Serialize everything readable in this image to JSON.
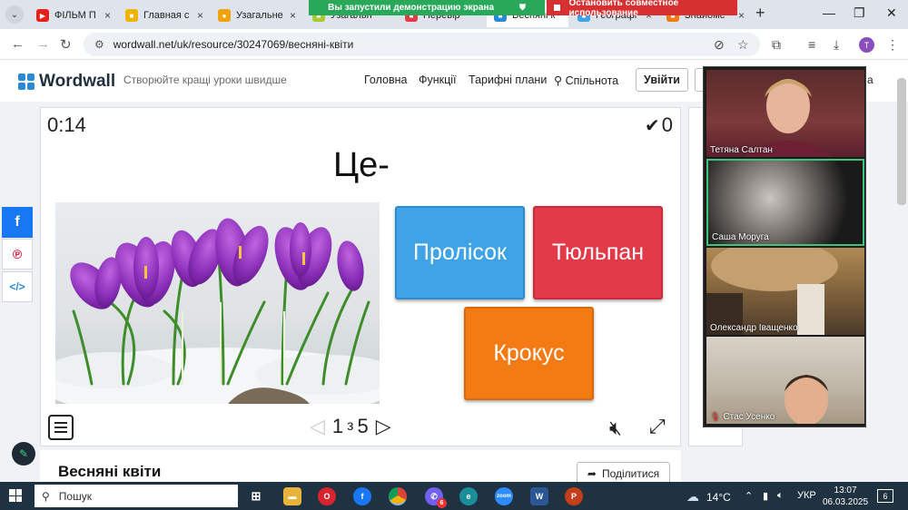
{
  "browser": {
    "tabs": [
      {
        "title": "ФІЛЬМ П",
        "color": "#e62117"
      },
      {
        "title": "Главная с",
        "color": "#f0b400"
      },
      {
        "title": "Узагальне",
        "color": "#f2a20c"
      },
      {
        "title": "Узагальн",
        "color": "#a8c934"
      },
      {
        "title": "Перевір",
        "color": "#e23a48"
      },
      {
        "title": "Весняні к",
        "color": "#2b8ad6"
      },
      {
        "title": "Географі",
        "color": "#3fa3e8"
      },
      {
        "title": "Знайомс",
        "color": "#f47a14"
      }
    ],
    "url": "wordwall.net/uk/resource/30247069/весняні-квіти",
    "profile_initial": "T",
    "share_banner": "Вы запустили демонстрацию экрана",
    "stop_share": "Остановить совместное использование"
  },
  "site": {
    "logo": "Wordwall",
    "tagline": "Створюйте кращі уроки швидше",
    "nav": [
      "Головна",
      "Функції",
      "Тарифні плани",
      "Спільнота"
    ],
    "login": "Увійти",
    "lang_suffix": "а"
  },
  "activity": {
    "timer": "0:14",
    "score": "0",
    "question": "Це-",
    "answers": [
      "Пролісок",
      "Тюльпан",
      "Крокус"
    ],
    "page_current": "1",
    "page_sep": "з",
    "page_total": "5",
    "title": "Весняні квіти",
    "share_label": "Поділитися"
  },
  "participants": [
    "Тетяна Салтан",
    "Саша Моруга",
    "Олександр Іващенко",
    "Стас Усенко"
  ],
  "taskbar": {
    "search": "Пошук",
    "temperature": "14°C",
    "language": "УКР",
    "time": "13:07",
    "date": "06.03.2025",
    "notifications": "6",
    "viber_badge": "6"
  }
}
